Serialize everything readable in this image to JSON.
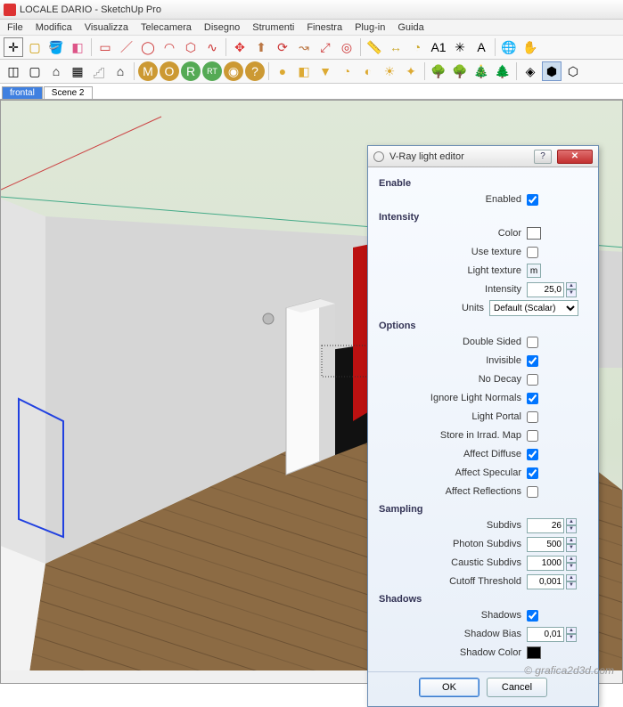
{
  "window": {
    "title": "LOCALE DARIO - SketchUp Pro"
  },
  "menu": [
    "File",
    "Modifica",
    "Visualizza",
    "Telecamera",
    "Disegno",
    "Strumenti",
    "Finestra",
    "Plug-in",
    "Guida"
  ],
  "scenes": [
    {
      "label": "frontal",
      "active": true
    },
    {
      "label": "Scene 2",
      "active": false
    }
  ],
  "dialog": {
    "title": "V-Ray light editor",
    "sections": {
      "enable": {
        "title": "Enable",
        "enabled": {
          "label": "Enabled",
          "checked": true
        }
      },
      "intensity": {
        "title": "Intensity",
        "color": {
          "label": "Color",
          "value": "#ffffff"
        },
        "useTexture": {
          "label": "Use texture",
          "checked": false
        },
        "lightTexture": {
          "label": "Light texture",
          "btn": "m"
        },
        "intensity": {
          "label": "Intensity",
          "value": "25,0"
        },
        "units": {
          "label": "Units",
          "value": "Default (Scalar)"
        }
      },
      "options": {
        "title": "Options",
        "doubleSided": {
          "label": "Double Sided",
          "checked": false
        },
        "invisible": {
          "label": "Invisible",
          "checked": true
        },
        "noDecay": {
          "label": "No Decay",
          "checked": false
        },
        "ignoreLightNormals": {
          "label": "Ignore Light Normals",
          "checked": true
        },
        "lightPortal": {
          "label": "Light Portal",
          "checked": false
        },
        "storeIrrad": {
          "label": "Store in Irrad. Map",
          "checked": false
        },
        "affectDiffuse": {
          "label": "Affect Diffuse",
          "checked": true
        },
        "affectSpecular": {
          "label": "Affect Specular",
          "checked": true
        },
        "affectReflections": {
          "label": "Affect Reflections",
          "checked": false
        }
      },
      "sampling": {
        "title": "Sampling",
        "subdivs": {
          "label": "Subdivs",
          "value": "26"
        },
        "photonSubdivs": {
          "label": "Photon Subdivs",
          "value": "500"
        },
        "causticSubdivs": {
          "label": "Caustic Subdivs",
          "value": "1000"
        },
        "cutoffThreshold": {
          "label": "Cutoff Threshold",
          "value": "0,001"
        }
      },
      "shadows": {
        "title": "Shadows",
        "shadows": {
          "label": "Shadows",
          "checked": true
        },
        "shadowBias": {
          "label": "Shadow Bias",
          "value": "0,01"
        },
        "shadowColor": {
          "label": "Shadow Color",
          "value": "#000000"
        }
      }
    },
    "buttons": {
      "ok": "OK",
      "cancel": "Cancel"
    }
  },
  "watermark": "© grafica2d3d.com"
}
